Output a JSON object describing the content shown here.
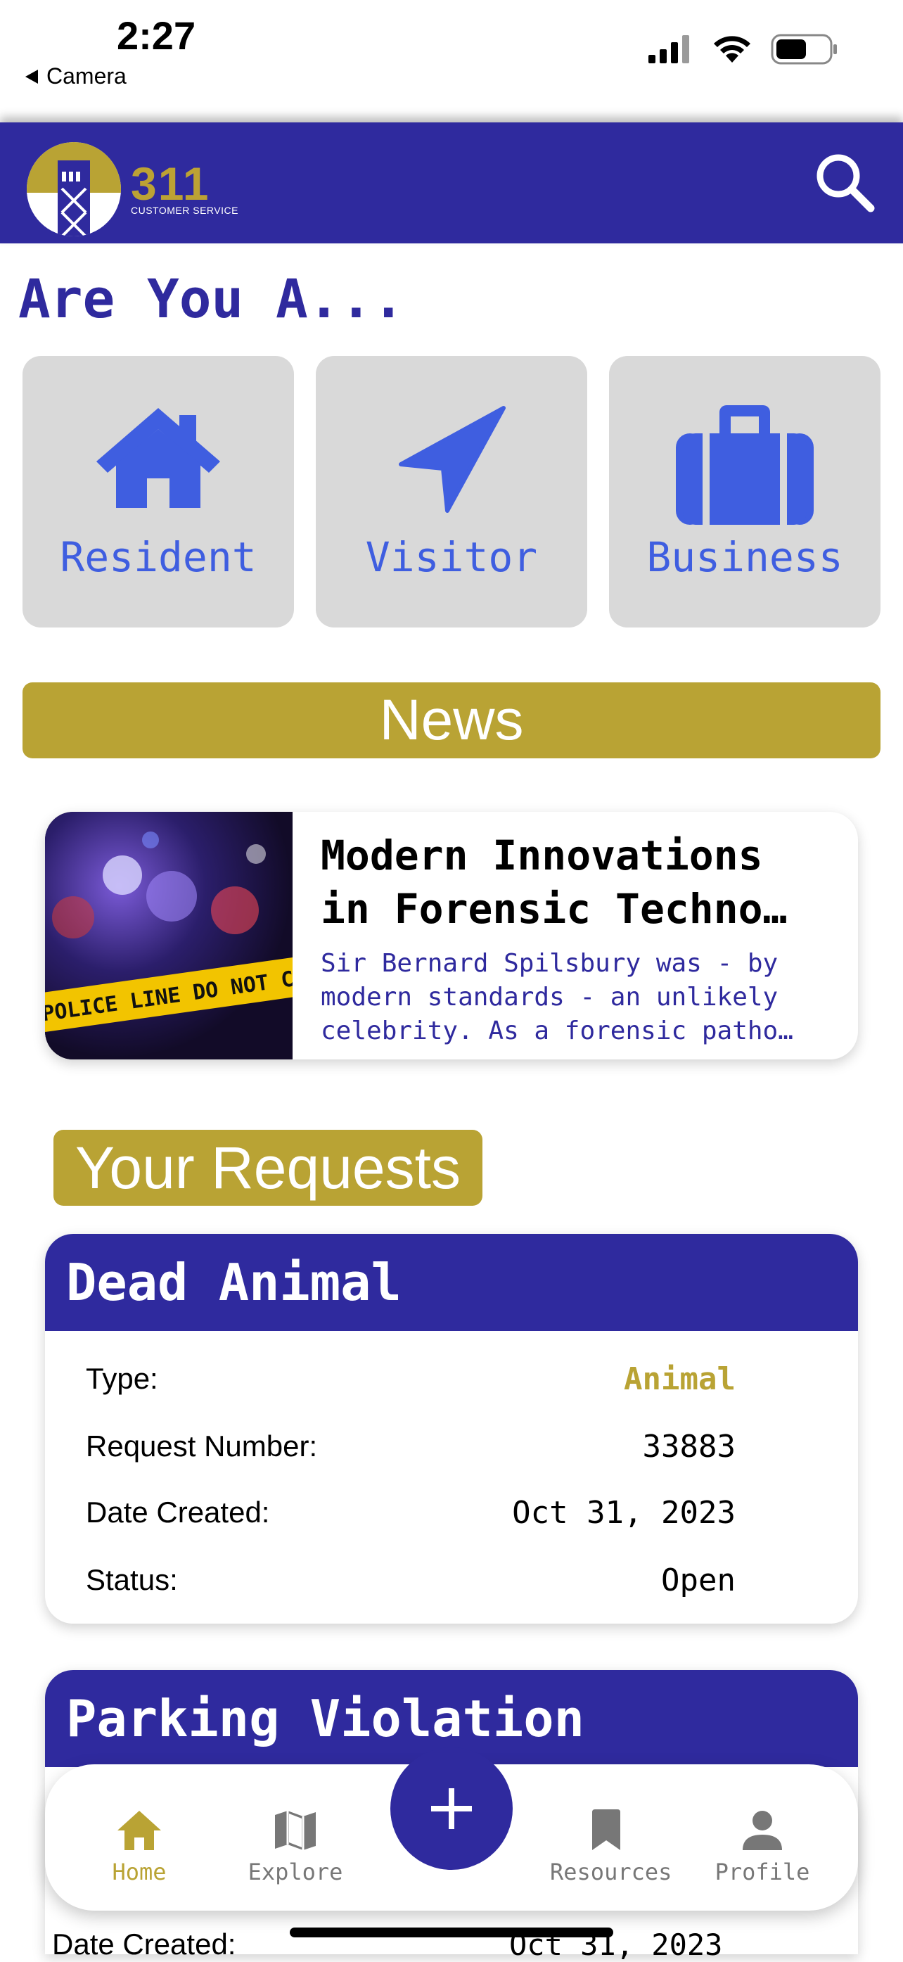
{
  "status_bar": {
    "time": "2:27",
    "back_label": "Camera"
  },
  "header": {
    "logo_number": "311",
    "logo_caption": "CUSTOMER SERVICE"
  },
  "roles": {
    "title": "Are You A...",
    "items": [
      {
        "label": "Resident",
        "icon": "home-icon"
      },
      {
        "label": "Visitor",
        "icon": "location-arrow-icon"
      },
      {
        "label": "Business",
        "icon": "briefcase-icon"
      }
    ]
  },
  "news": {
    "section_label": "News",
    "article": {
      "title": "Modern Innovations in Forensic Techno…",
      "snippet": "Sir Bernard Spilsbury was - by modern standards - an unlikely celebrity. As a forensic patho…",
      "image_tape_text": "POLICE LINE DO NOT CROSS"
    }
  },
  "requests": {
    "section_label": "Your Requests",
    "labels": {
      "type": "Type:",
      "request_number": "Request Number:",
      "date_created": "Date Created:",
      "status": "Status:"
    },
    "items": [
      {
        "title": "Dead Animal",
        "type": "Animal",
        "request_number": "33883",
        "date_created": "Oct 31, 2023",
        "status": "Open"
      },
      {
        "title": "Parking Violation",
        "date_created_partial": "Oct 31, 2023"
      }
    ]
  },
  "bottom_nav": {
    "items": [
      {
        "label": "Home",
        "icon": "home-icon",
        "active": true
      },
      {
        "label": "Explore",
        "icon": "map-icon",
        "active": false
      },
      {
        "label": "Resources",
        "icon": "bookmark-icon",
        "active": false
      },
      {
        "label": "Profile",
        "icon": "person-icon",
        "active": false
      }
    ],
    "add_icon": "plus-icon"
  },
  "colors": {
    "primary": "#2f2a9e",
    "accent": "#b9a334",
    "role_icon": "#3f5ee0",
    "card_bg": "#d9d9d9"
  }
}
